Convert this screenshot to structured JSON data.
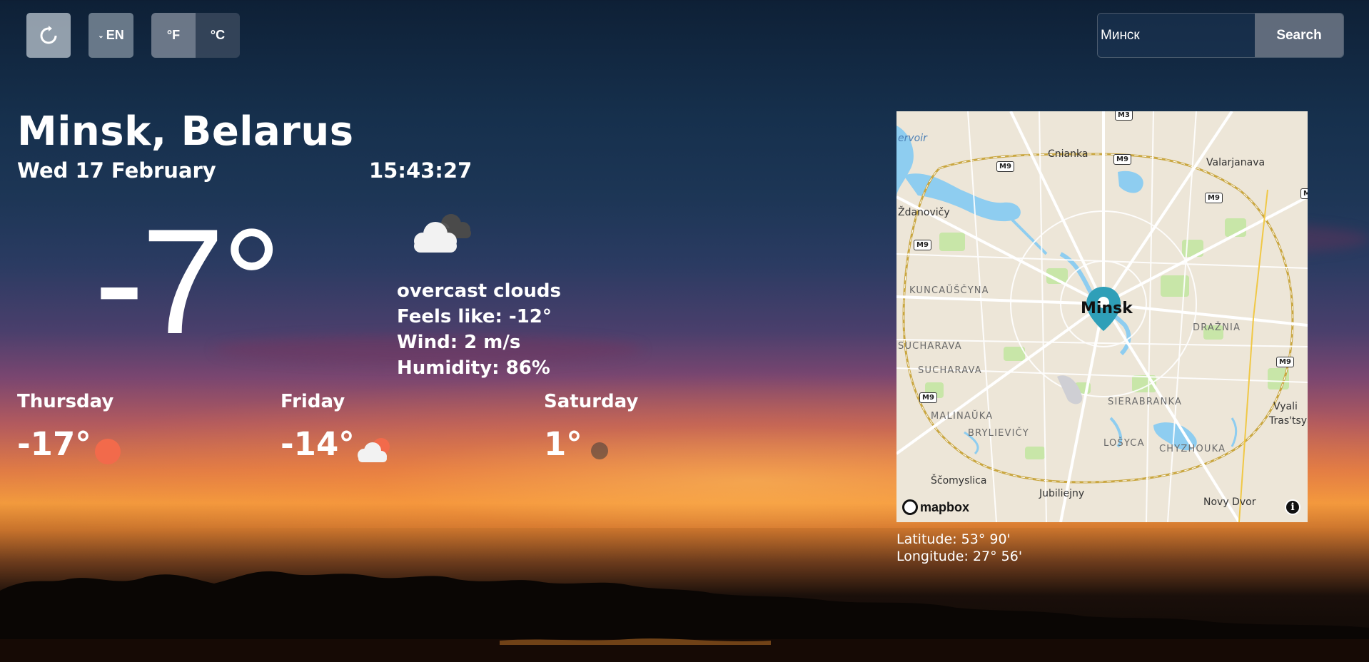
{
  "toolbar": {
    "refresh_icon": "refresh-icon",
    "language": "EN",
    "unit_f": "°F",
    "unit_c": "°C",
    "active_unit": "°C"
  },
  "search": {
    "value": "Минск",
    "placeholder": "",
    "button_label": "Search"
  },
  "location": {
    "city": "Minsk, Belarus",
    "date": "Wed 17 February",
    "time": "15:43:27"
  },
  "current": {
    "temperature": "-7°",
    "icon": "overcast-clouds-icon",
    "description": "overcast clouds",
    "feels_like": "Feels like: -12°",
    "wind": "Wind: 2 m/s",
    "humidity": "Humidity: 86%"
  },
  "forecast": [
    {
      "day": "Thursday",
      "temp": "-17°",
      "icon": "sun-icon"
    },
    {
      "day": "Friday",
      "temp": "-14°",
      "icon": "cloud-sun-icon"
    },
    {
      "day": "Saturday",
      "temp": "1°",
      "icon": "dim-circle-icon"
    }
  ],
  "map": {
    "center_label": "Minsk",
    "labels": {
      "cnianka": "Cnianka",
      "valarjanava": "Valarjanava",
      "zdanovicy": "Ždanovičy",
      "kuncausyna": "KUNCAŬŠČYNA",
      "sucharava1": "SUCHARAVA",
      "sucharava2": "SUCHARAVA",
      "drazhnia": "DRAŽNIA",
      "malinauka": "MALINAŬKA",
      "brylievicy": "BRYLIEVIČY",
      "sierabranka": "SIERABRANKA",
      "losyca": "LOŠYCA",
      "chyzhouka": "CHYZHOUKA",
      "scomyslica": "Ščomyslica",
      "jubiliejny": "Jubiliejny",
      "novy_dvor": "Novy Dvor",
      "vyali": "Vyali",
      "trastsya": "Tras'tsya",
      "ervoir": "ervoir"
    },
    "shields": {
      "m3": "M3",
      "m9_a": "M9",
      "m9_b": "M9",
      "m9_c": "M9",
      "m9_d": "M9",
      "m9_e": "M9",
      "m9_f": "M9",
      "m_edge": "M"
    },
    "attribution": "mapbox",
    "info_glyph": "i",
    "accent_pin": "#2f9fb8",
    "water": "#8ecdf0",
    "park": "#c8e6a8"
  },
  "coordinates": {
    "latitude": "Latitude: 53° 90'",
    "longitude": "Longitude: 27° 56'"
  },
  "colors": {
    "sun": "#f26a4b",
    "text": "#ffffff"
  }
}
